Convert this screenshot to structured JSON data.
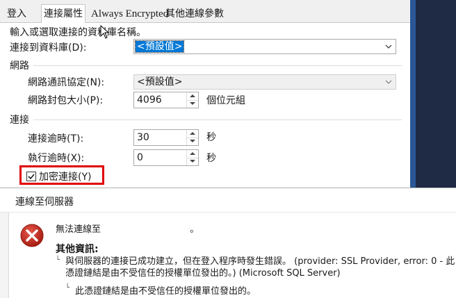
{
  "tabs": [
    "登入",
    "連接屬性",
    "Always Encrypted",
    "其他連線參數"
  ],
  "active_tab": "連接屬性",
  "instruction": "輸入或選取連接的資料庫名稱。",
  "connect_db": {
    "label": "連接到資料庫(D):",
    "value": "<預設值>"
  },
  "network": {
    "group_label": "網路",
    "protocol": {
      "label": "網路通訊協定(N):",
      "value": "<預設值>"
    },
    "packet_size": {
      "label": "網路封包大小(P):",
      "value": "4096",
      "unit": "個位元組"
    }
  },
  "connection": {
    "group_label": "連接",
    "timeout": {
      "label": "連接逾時(T):",
      "value": "30",
      "unit": "秒"
    },
    "exec_timeout": {
      "label": "執行逾時(X):",
      "value": "0",
      "unit": "秒"
    },
    "encrypt": {
      "label": "加密連接(Y)",
      "checked": true
    }
  },
  "error_dialog": {
    "title": "連線至伺服器",
    "message_prefix": "無法連線至",
    "message_suffix": "。",
    "more_info": "其他資訊:",
    "detail_line1": "與伺服器的連接已成功建立，但在登入程序時發生錯誤。 (provider: SSL Provider, error: 0 - 此",
    "detail_line2": "憑證鏈結是由不受信任的授權單位發出的。) (Microsoft SQL Server)",
    "detail_sub": "此憑證鏈結是由不受信任的授權單位發出的。"
  },
  "colors": {
    "highlight": "#e00000",
    "selection": "#0078d7",
    "error_icon": "#c42b1c"
  }
}
